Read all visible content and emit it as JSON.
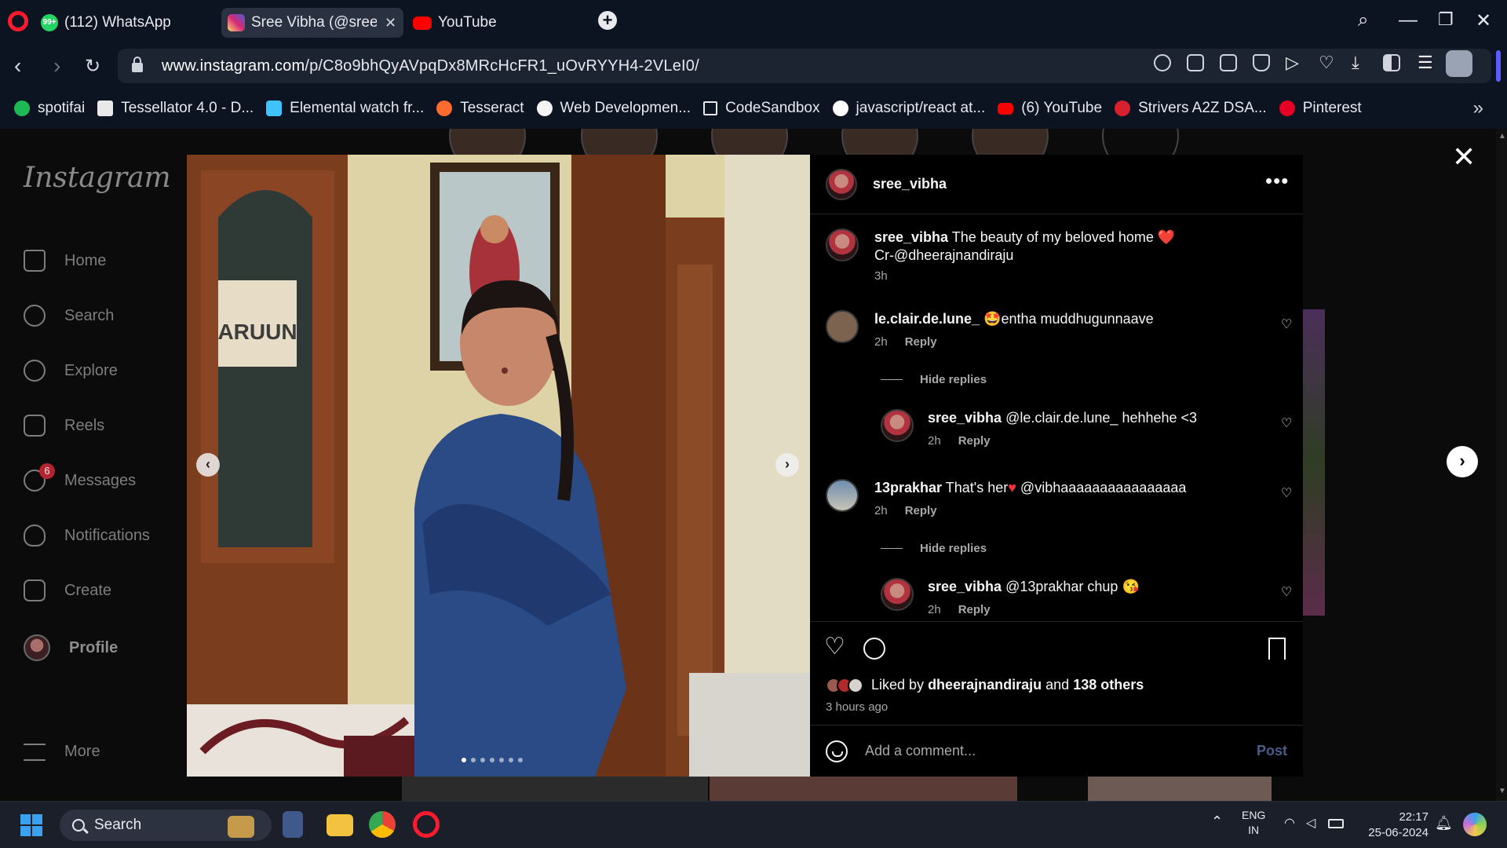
{
  "browser": {
    "tabs": [
      {
        "title": "(112) WhatsApp",
        "favicon": "whatsapp-icon",
        "badge": "99+",
        "active": false
      },
      {
        "title": "Sree Vibha (@sree_v",
        "favicon": "instagram-icon",
        "active": true
      },
      {
        "title": "YouTube",
        "favicon": "youtube-icon",
        "active": false
      }
    ],
    "url_host": "www.instagram.com",
    "url_path": "/p/C8o9bhQyAVpqDx8MRcHcFR1_uOvRYYH4-2VLeI0/",
    "bookmarks": [
      {
        "label": "spotifai",
        "color": "#1db954"
      },
      {
        "label": "Tessellator 4.0 - D...",
        "color": "#e9e9e9"
      },
      {
        "label": "Elemental watch fr...",
        "color": "#3ec3ff"
      },
      {
        "label": "Tesseract",
        "color": "#ff6b2c"
      },
      {
        "label": "Web Developmen...",
        "color": "#f4f4f4"
      },
      {
        "label": "CodeSandbox",
        "color": "#0d1421"
      },
      {
        "label": "javascript/react at...",
        "color": "#ffffff"
      },
      {
        "label": "(6) YouTube",
        "color": "#ff0000"
      },
      {
        "label": "Strivers A2Z DSA...",
        "color": "#d9202d"
      },
      {
        "label": "Pinterest",
        "color": "#e60023"
      }
    ]
  },
  "instagram": {
    "logo": "Instagram",
    "nav": [
      {
        "label": "Home",
        "icon": "home-icon"
      },
      {
        "label": "Search",
        "icon": "search-icon"
      },
      {
        "label": "Explore",
        "icon": "compass-icon"
      },
      {
        "label": "Reels",
        "icon": "reels-icon"
      },
      {
        "label": "Messages",
        "icon": "messenger-icon",
        "badge": "6"
      },
      {
        "label": "Notifications",
        "icon": "heart-icon"
      },
      {
        "label": "Create",
        "icon": "plus-square-icon"
      },
      {
        "label": "Profile",
        "icon": "avatar"
      },
      {
        "label": "More",
        "icon": "menu-icon"
      }
    ]
  },
  "post": {
    "photo_sign": "ARUUN",
    "slide_count": 7,
    "current_slide": 1,
    "author": "sree_vibha",
    "caption_user": "sree_vibha",
    "caption_text": "The beauty of my beloved home ❤️",
    "caption_credit": "Cr-@dheerajnandiraju",
    "caption_time": "3h",
    "comments": [
      {
        "user": "le.clair.de.lune_",
        "text": "🤩entha muddhugunnaave",
        "time": "2h",
        "reply": "Reply"
      },
      {
        "user": "sree_vibha",
        "text": "@le.clair.de.lune_ hehhehe <3",
        "time": "2h",
        "reply": "Reply"
      },
      {
        "user": "13prakhar",
        "text_a": "That's her",
        "text_b": " @vibhaaaaaaaaaaaaaaaa",
        "time": "2h",
        "reply": "Reply"
      },
      {
        "user": "sree_vibha",
        "text": "@13prakhar chup 😘",
        "time": "2h",
        "reply": "Reply"
      }
    ],
    "hide_replies": "Hide replies",
    "liked_by_prefix": "Liked by",
    "liked_by_user": "dheerajnandiraju",
    "liked_by_and": "and",
    "liked_by_others": "138 others",
    "posted_ago": "3 hours ago",
    "comment_placeholder": "Add a comment...",
    "post_button": "Post"
  },
  "taskbar": {
    "search_label": "Search",
    "lang_top": "ENG",
    "lang_bottom": "IN",
    "time": "22:17",
    "date": "25-06-2024"
  }
}
